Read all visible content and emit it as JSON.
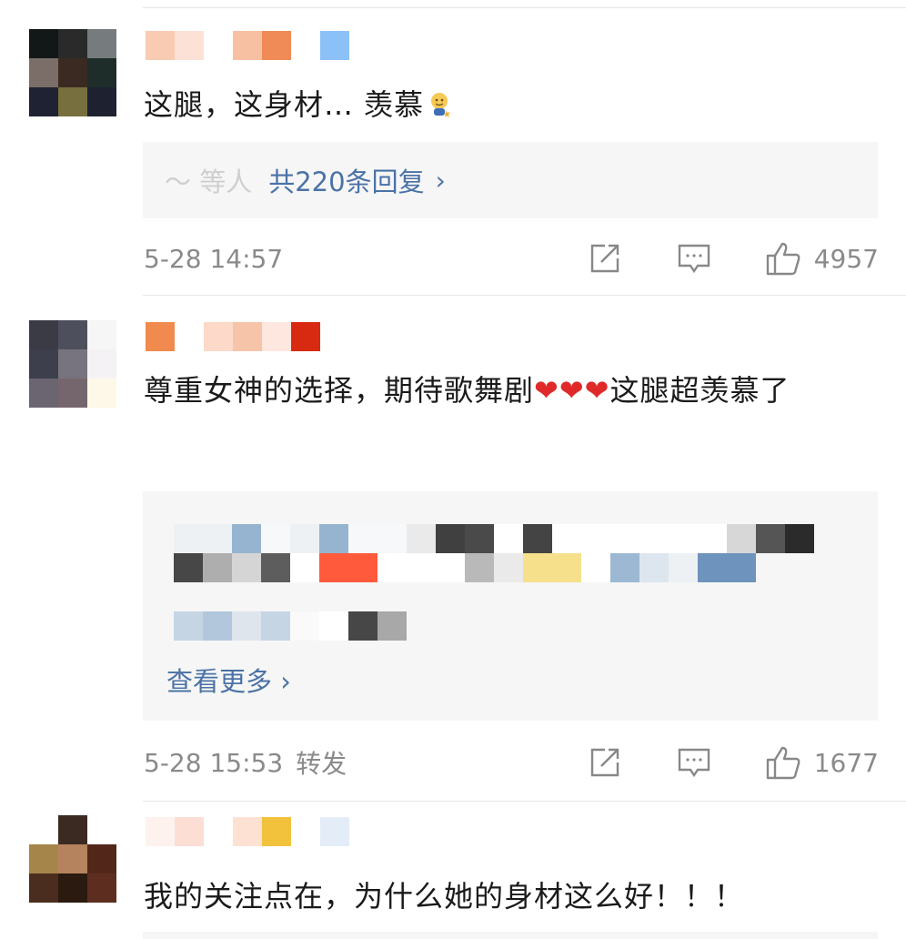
{
  "comments": [
    {
      "avatar_colors": [
        "#111817",
        "#2a2a2a",
        "#767b7d",
        "#7b6e68",
        "#3a2a22",
        "#1f2d2a",
        "#1f2233",
        "#77703e",
        "#1e2230"
      ],
      "name_colors": [
        "#f9cbb3",
        "#fbe1d6",
        "#ffffff",
        "#f7c0a2",
        "#f08a56",
        "#ffffff",
        "#8cc1f7"
      ],
      "text": "这腿，这身材… 羡慕",
      "emoji": "drooling-emoji",
      "reply": {
        "who": "～ 等人",
        "total": "共220条回复",
        "chevron": "›"
      },
      "time": "5-28 14:57",
      "extra": "",
      "likes": "4957"
    },
    {
      "avatar_colors": [
        "#3a3b45",
        "#4e4f5c",
        "#f6f6f6",
        "#3d3f4c",
        "#77737f",
        "#f5f2f5",
        "#6b6571",
        "#75666e",
        "#fdf8e8"
      ],
      "name_colors": [
        "#f08a4e",
        "#ffffff",
        "#fcd9c8",
        "#f6c4a9",
        "#fde7df",
        "#d82a10"
      ],
      "text": "尊重女神的选择，期待歌舞剧",
      "hearts": "❤❤❤",
      "text_after": "这腿超羡慕了",
      "reply_mosaic": [
        [
          "#eef1f4",
          "#eef1f4",
          "#96b4cf",
          "#f7f8fa",
          "#eef1f4",
          "#96b4cf",
          "#f7f8fa",
          "#f7f8fa",
          "#eaeaea",
          "#404040",
          "#4a4a4a",
          "#ffffff",
          "#444444",
          "#ffffff",
          "#ffffff",
          "#ffffff",
          "#ffffff",
          "#ffffff",
          "#ffffff",
          "#d7d7d7",
          "#555555",
          "#2b2b2b"
        ],
        [
          "#474747",
          "#aeaeae",
          "#d5d5d5",
          "#5d5d5d",
          "#ffffff",
          "#ff5a3c",
          "#ff5a3c",
          "#ffffff",
          "#ffffff",
          "#ffffff",
          "#b9b9b9",
          "#eaeaea",
          "#f6e08c",
          "#f6e08c",
          "#ffffff",
          "#9cb8d3",
          "#dde6ef",
          "#eef1f4",
          "#6e93bd",
          "#6e93bd"
        ],
        [
          "#c6d5e4",
          "#b2c7dc",
          "#dfe5ed",
          "#c6d5e4",
          "#fafafa",
          "#ffffff",
          "#474747",
          "#a8a8a8"
        ]
      ],
      "see_more": "查看更多 ›",
      "time": "5-28 15:53",
      "extra": "转发",
      "likes": "1677"
    },
    {
      "avatar_colors": [
        "#ffffff",
        "#3b2a22",
        "#ffffff",
        "#a6854a",
        "#b5835e",
        "#52271a",
        "#4b2d1f",
        "#2a1a10",
        "#5d2e20"
      ],
      "name_colors": [
        "#fdf2ee",
        "#fcded5",
        "#ffffff",
        "#fde2d4",
        "#f2c23c",
        "#ffffff",
        "#e3ecf7"
      ],
      "text": "我的关注点在，为什么她的身材这么好！！！"
    }
  ],
  "icons": {
    "share": "share-icon",
    "comment": "comment-icon",
    "like": "like-icon"
  }
}
